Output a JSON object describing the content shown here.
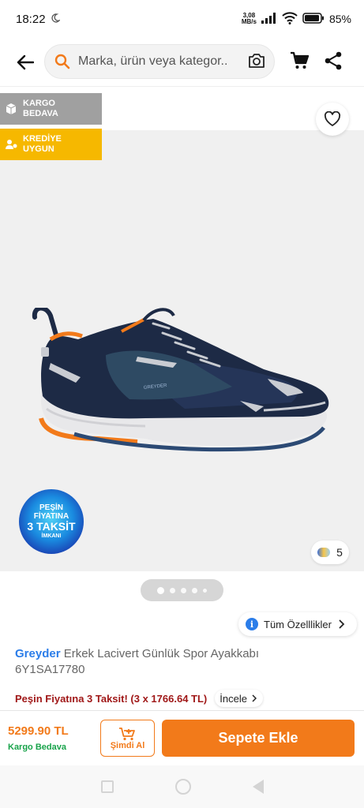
{
  "status_bar": {
    "time": "18:22",
    "net_speed_value": "3,08",
    "net_speed_unit": "MB/s",
    "battery": "85%"
  },
  "header": {
    "search_placeholder": "Marka, ürün veya kategor..."
  },
  "gallery": {
    "badges": [
      {
        "line1": "KARGO",
        "line2": "BEDAVA"
      },
      {
        "line1": "KREDİYE",
        "line2": "UYGUN"
      }
    ],
    "promo": {
      "line1": "PEŞİN",
      "line2": "FİYATINA",
      "line3": "3 TAKSİT",
      "line4": "İMKANI"
    },
    "shoe_brand_label": "GREYDER",
    "color_count": "5",
    "pager": {
      "total": 5,
      "active": 1
    }
  },
  "product": {
    "features_button": "Tüm Özelllikler",
    "brand": "Greyder",
    "name": "Erkek Lacivert Günlük Spor Ayakkabı",
    "code": "6Y1SA17780",
    "installment_text": "Peşin Fiyatına 3 Taksit! (3 x 1766.64 TL)",
    "incele_label": "İncele"
  },
  "bottom_bar": {
    "price": "5299.90 TL",
    "shipping": "Kargo Bedava",
    "buy_now_label": "Şimdi Al",
    "add_to_cart_label": "Sepete Ekle"
  },
  "colors": {
    "accent": "#f27a1a",
    "brand_link": "#2b7de9",
    "installment_red": "#a01818",
    "free_green": "#18a34a",
    "credit_yellow": "#f6b800"
  }
}
